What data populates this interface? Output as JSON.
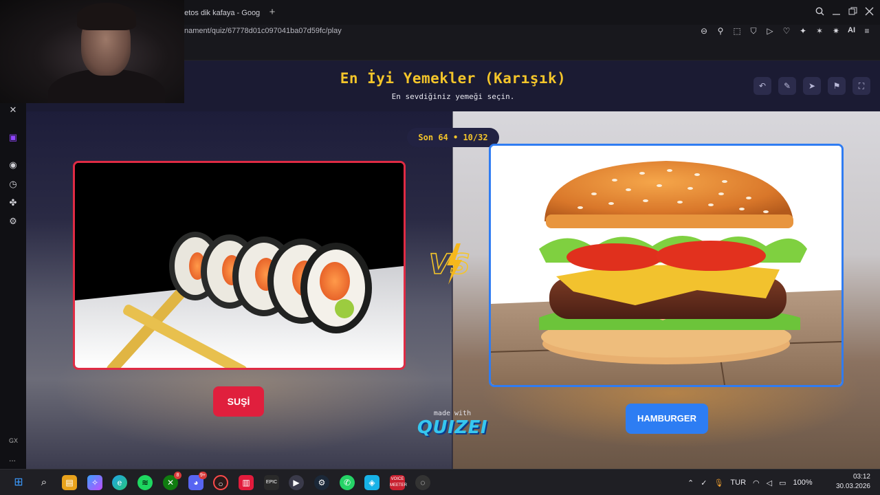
{
  "browser": {
    "tab_title": "eetos dik kafaya - Goog",
    "new_tab_symbol": "+",
    "url": "nament/quiz/67778d01c097041ba07d59fc/play",
    "toolbar_icons": [
      "zoom-out-icon",
      "pin-icon",
      "snapshot-icon",
      "shield-icon",
      "play-icon",
      "heart-icon",
      "extension-icon",
      "extension-icon",
      "extension-icon",
      "ai-icon",
      "menu-icon"
    ],
    "ai_label": "AI"
  },
  "sidebar": {
    "icons": [
      "x-icon",
      "twitch-icon",
      "spotify-icon",
      "history-icon",
      "extensions-icon",
      "settings-icon"
    ],
    "gx_label": "GX",
    "more_label": "..."
  },
  "quiz": {
    "title": "En İyi Yemekler (Karışık)",
    "subtitle": "En sevdiğiniz yemeği seçin.",
    "round": "Son 64 • 10/32",
    "left_option": "SUŞİ",
    "right_option": "HAMBURGER",
    "vs_text": "VS",
    "made_with": "made with",
    "brand": "QUIZEI",
    "header_buttons": [
      "undo-icon",
      "edit-icon",
      "share-icon",
      "flag-icon",
      "fullscreen-icon"
    ],
    "colors": {
      "title": "#f4c52a",
      "left_accent": "#e01f3d",
      "right_accent": "#2d7df3",
      "header_bg": "#1b1b33"
    }
  },
  "taskbar": {
    "apps": [
      "windows-start-icon",
      "search-icon",
      "file-explorer-icon",
      "copilot-icon",
      "edge-icon",
      "spotify-icon",
      "xbox-icon",
      "discord-icon",
      "opera-gx-icon",
      "app-icon",
      "epic-games-icon",
      "media-player-icon",
      "steam-icon",
      "whatsapp-icon",
      "kodi-icon",
      "voicemeeter-icon",
      "app-icon"
    ],
    "xbox_badge": "8",
    "discord_badge": "9+",
    "language": "TUR",
    "battery": "100%",
    "time": "03:12",
    "date": "30.03.2026"
  }
}
